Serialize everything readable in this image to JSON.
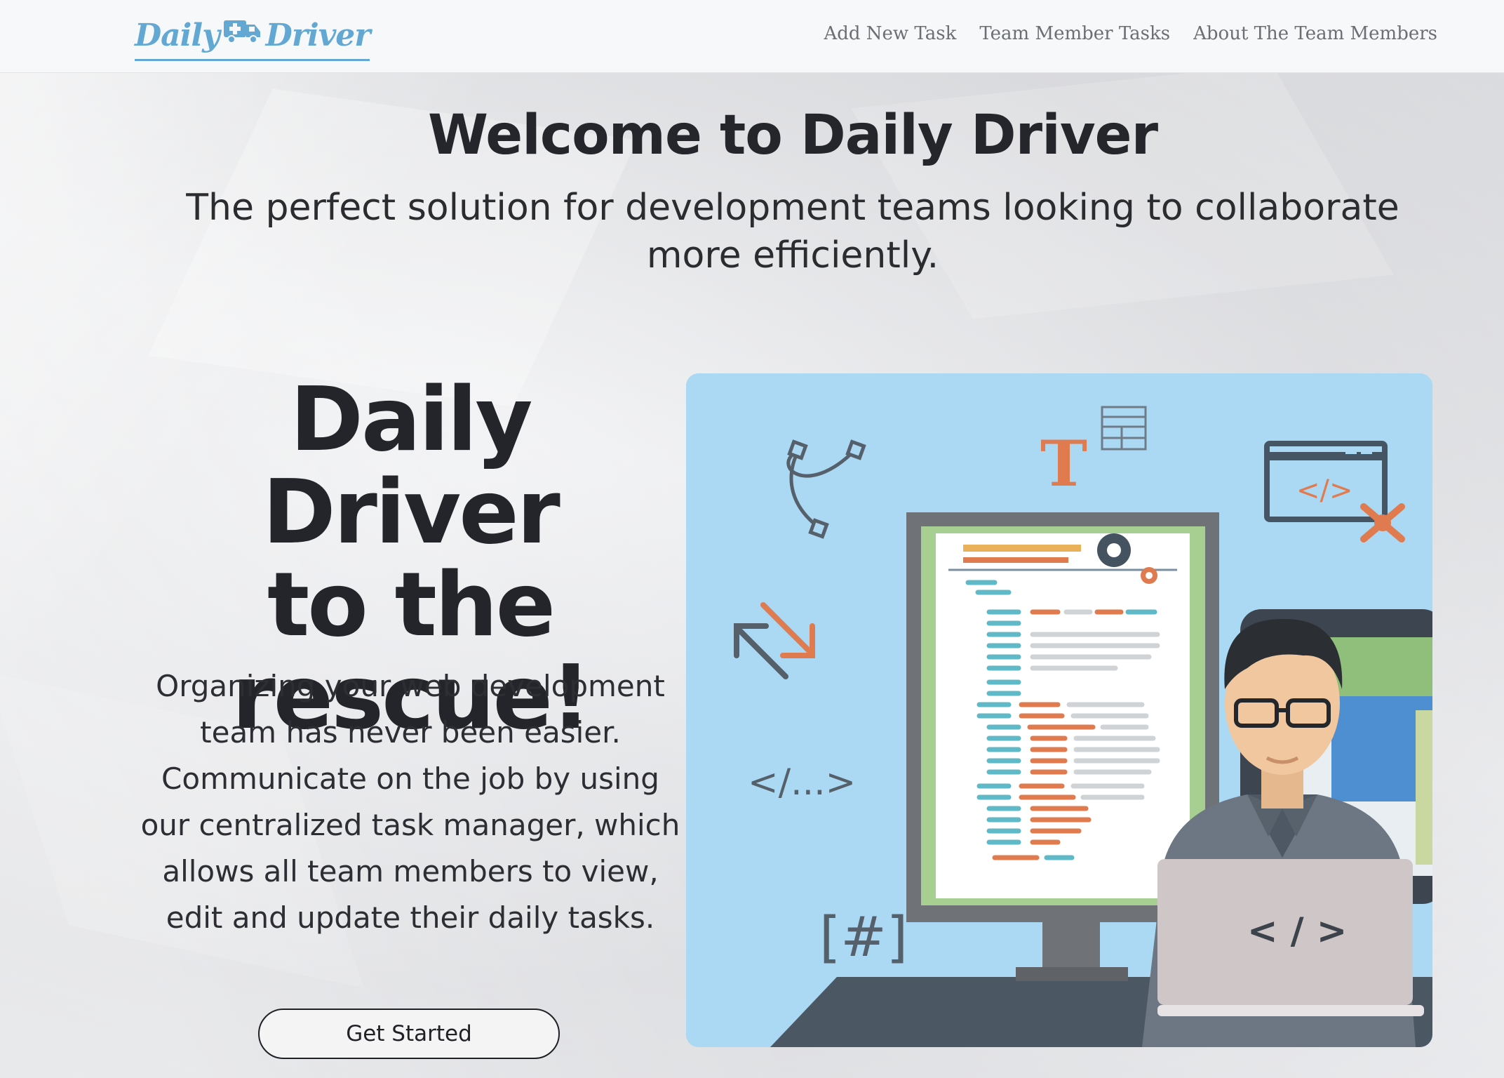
{
  "navbar": {
    "brand": {
      "left": "Daily",
      "right": "Driver"
    },
    "links": [
      "Add New Task",
      "Team Member Tasks",
      "About The Team Members"
    ]
  },
  "hero": {
    "title": "Welcome to Daily Driver",
    "subtitle": "The perfect solution for development teams looking to collaborate more efficiently."
  },
  "feature": {
    "tagline_lines": [
      "Daily Driver",
      "to the",
      "rescue!"
    ],
    "description": "Organizing your web development team has never been easier. Communicate on the job by using our centralized task manager, which allows all team members to view, edit and update their daily tasks.",
    "cta_label": "Get Started"
  },
  "illustration": {
    "code_glyphs": [
      "T",
      "</>",
      "</...>",
      "[#]",
      "< / >"
    ]
  },
  "colors": {
    "brand_blue": "#63a8d3",
    "illustration_bg": "#abd8f3",
    "accent_orange": "#e07b4f",
    "code_teal": "#5fb9c7",
    "monitor_gray": "#6f7377"
  },
  "icons": [
    "ambulance-truck-icon",
    "bezier-curve-icon",
    "text-tool-icon",
    "layout-grid-icon",
    "code-window-icon",
    "wrench-icon",
    "resize-arrows-icon",
    "gear-icon",
    "laptop-icon"
  ]
}
